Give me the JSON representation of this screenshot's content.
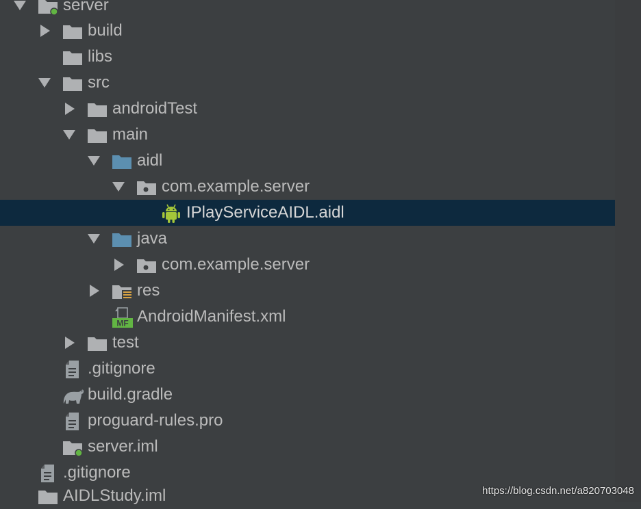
{
  "tree": {
    "items": [
      {
        "label": "server",
        "icon": "module-folder-icon",
        "arrow": "expanded"
      },
      {
        "label": "build",
        "icon": "folder-icon",
        "arrow": "collapsed"
      },
      {
        "label": "libs",
        "icon": "folder-icon",
        "arrow": "none"
      },
      {
        "label": "src",
        "icon": "folder-icon",
        "arrow": "expanded"
      },
      {
        "label": "androidTest",
        "icon": "folder-icon",
        "arrow": "collapsed"
      },
      {
        "label": "main",
        "icon": "folder-icon",
        "arrow": "expanded"
      },
      {
        "label": "aidl",
        "icon": "source-folder-icon",
        "arrow": "expanded"
      },
      {
        "label": "com.example.server",
        "icon": "package-icon",
        "arrow": "expanded"
      },
      {
        "label": "IPlayServiceAIDL.aidl",
        "icon": "android-icon",
        "arrow": "none",
        "selected": true
      },
      {
        "label": "java",
        "icon": "source-folder-icon",
        "arrow": "expanded"
      },
      {
        "label": "com.example.server",
        "icon": "package-icon",
        "arrow": "collapsed"
      },
      {
        "label": "res",
        "icon": "resource-folder-icon",
        "arrow": "collapsed"
      },
      {
        "label": "AndroidManifest.xml",
        "icon": "manifest-icon",
        "arrow": "none"
      },
      {
        "label": "test",
        "icon": "folder-icon",
        "arrow": "collapsed"
      },
      {
        "label": ".gitignore",
        "icon": "text-file-icon",
        "arrow": "none"
      },
      {
        "label": "build.gradle",
        "icon": "gradle-icon",
        "arrow": "none"
      },
      {
        "label": "proguard-rules.pro",
        "icon": "text-file-icon",
        "arrow": "none"
      },
      {
        "label": "server.iml",
        "icon": "module-file-icon",
        "arrow": "none"
      },
      {
        "label": ".gitignore",
        "icon": "text-file-icon",
        "arrow": "none"
      },
      {
        "label": "AIDLStudy.iml",
        "icon": "module-file-icon",
        "arrow": "none"
      }
    ]
  },
  "colors": {
    "background": "#3c3f41",
    "selection": "#0d293e",
    "text": "#bbbbbb",
    "folder": "#afb1b3",
    "source_folder": "#5c8fb0",
    "android_green": "#a4c639",
    "module_dot": "#62b543"
  },
  "watermark": "https://blog.csdn.net/a820703048"
}
